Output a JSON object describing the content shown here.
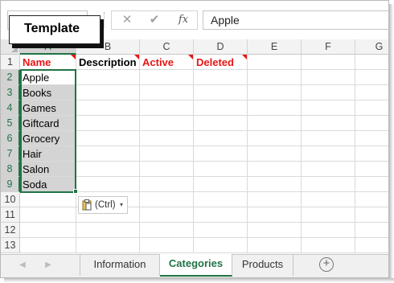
{
  "callout": {
    "label": "Template"
  },
  "formula_bar": {
    "name_box": "",
    "cancel_icon": "✕",
    "enter_icon": "✔",
    "fx_label": "fx",
    "value": "Apple"
  },
  "columns": [
    "A",
    "B",
    "C",
    "D",
    "E",
    "F",
    "G"
  ],
  "rows": [
    "1",
    "2",
    "3",
    "4",
    "5",
    "6",
    "7",
    "8",
    "9",
    "10",
    "11",
    "12",
    "13"
  ],
  "headers": {
    "a1": "Name",
    "b1": "Description",
    "c1": "Active",
    "d1": "Deleted"
  },
  "column_a": [
    "Apple",
    "Books",
    "Games",
    "Giftcard",
    "Grocery",
    "Hair",
    "Salon",
    "Soda"
  ],
  "paste_options": {
    "label": "(Ctrl)",
    "caret": "▾"
  },
  "sheet_tabs": {
    "nav_prev": "◀",
    "nav_next": "▶",
    "tabs": [
      "Information",
      "Categories",
      "Products"
    ],
    "active": "Categories",
    "add_icon": "+"
  },
  "colors": {
    "accent": "#217346",
    "header_red": "#e81616"
  }
}
